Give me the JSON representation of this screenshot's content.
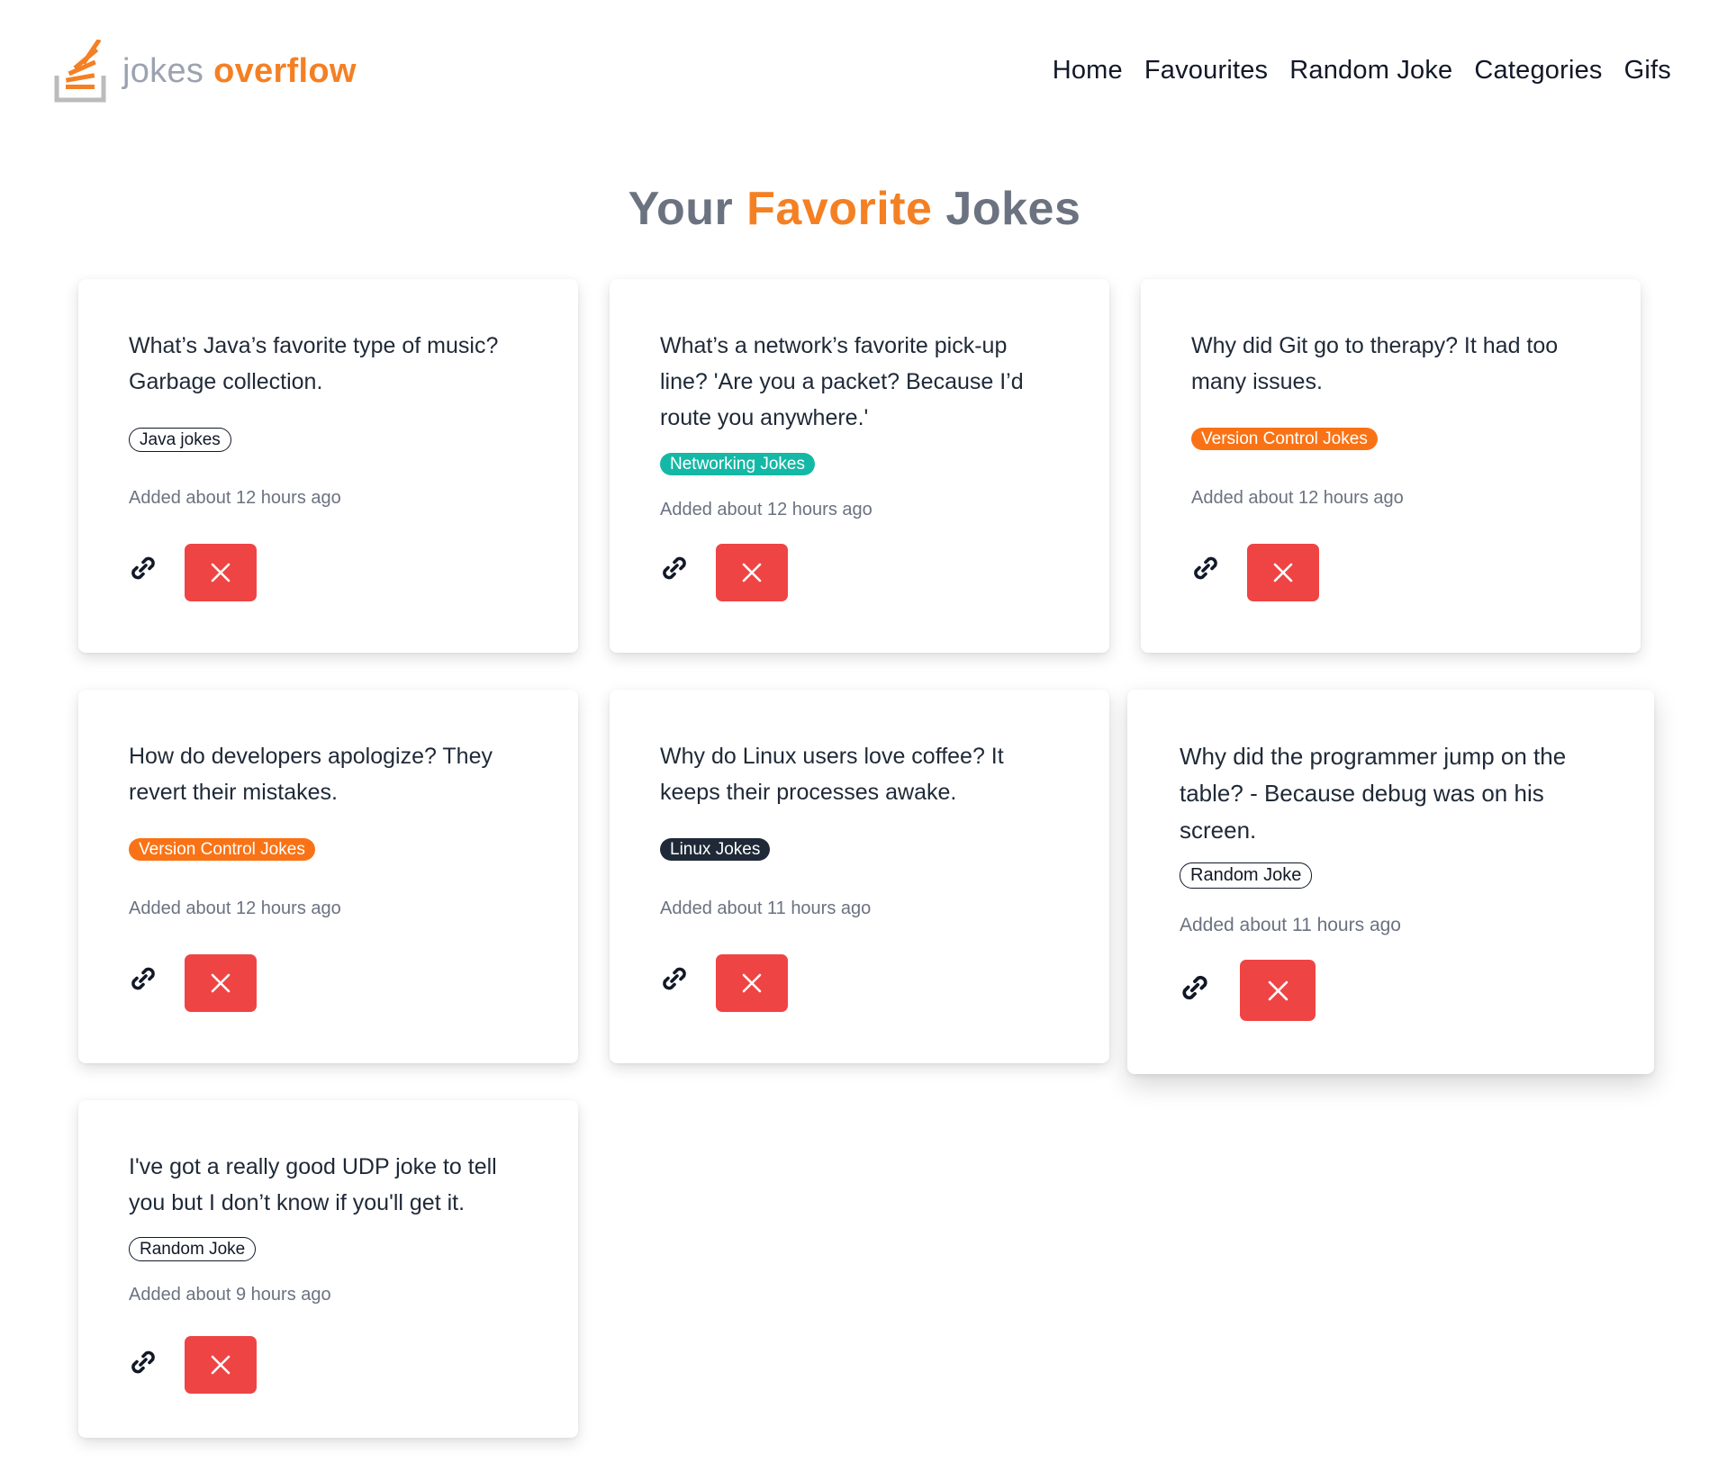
{
  "brand": {
    "word1": "jokes",
    "word2": "overflow",
    "logo_icon": "stack-overflow-logo-icon"
  },
  "nav": {
    "home": "Home",
    "favourites": "Favourites",
    "random_joke": "Random Joke",
    "categories": "Categories",
    "gifs": "Gifs"
  },
  "title": {
    "part1": "Your",
    "part2": "Favorite",
    "part3": "Jokes"
  },
  "colors": {
    "accent": "#f48024",
    "delete": "#ef4444",
    "tag_orange": "#f97316",
    "tag_teal": "#14b8a6",
    "tag_dark": "#1f2937"
  },
  "jokes": [
    {
      "text": "What’s Java’s favorite type of music? Garbage collection.",
      "category": "Java jokes",
      "category_style": "outline",
      "added": "Added about 12 hours ago",
      "link_icon": "link-icon",
      "delete_icon": "close-icon"
    },
    {
      "text": "What’s a network’s favorite pick-up line? 'Are you a packet? Because I’d route you anywhere.'",
      "category": "Networking Jokes",
      "category_style": "teal",
      "added": "Added about 12 hours ago",
      "link_icon": "link-icon",
      "delete_icon": "close-icon"
    },
    {
      "text": "Why did Git go to therapy? It had too many issues.",
      "category": "Version Control Jokes",
      "category_style": "orange",
      "added": "Added about 12 hours ago",
      "link_icon": "link-icon",
      "delete_icon": "close-icon"
    },
    {
      "text": "How do developers apologize? They revert their mistakes.",
      "category": "Version Control Jokes",
      "category_style": "orange",
      "added": "Added about 12 hours ago",
      "link_icon": "link-icon",
      "delete_icon": "close-icon"
    },
    {
      "text": "Why do Linux users love coffee? It keeps their processes awake.",
      "category": "Linux Jokes",
      "category_style": "dark",
      "added": "Added about 11 hours ago",
      "link_icon": "link-icon",
      "delete_icon": "close-icon"
    },
    {
      "text": "Why did the programmer jump on the table? - Because debug was on his screen.",
      "category": "Random Joke",
      "category_style": "outline",
      "added": "Added about 11 hours ago",
      "link_icon": "link-icon",
      "delete_icon": "close-icon"
    },
    {
      "text": "I've got a really good UDP joke to tell you but I don’t know if you'll get it.",
      "category": "Random Joke",
      "category_style": "outline",
      "added": "Added about 9 hours ago",
      "link_icon": "link-icon",
      "delete_icon": "close-icon"
    }
  ]
}
